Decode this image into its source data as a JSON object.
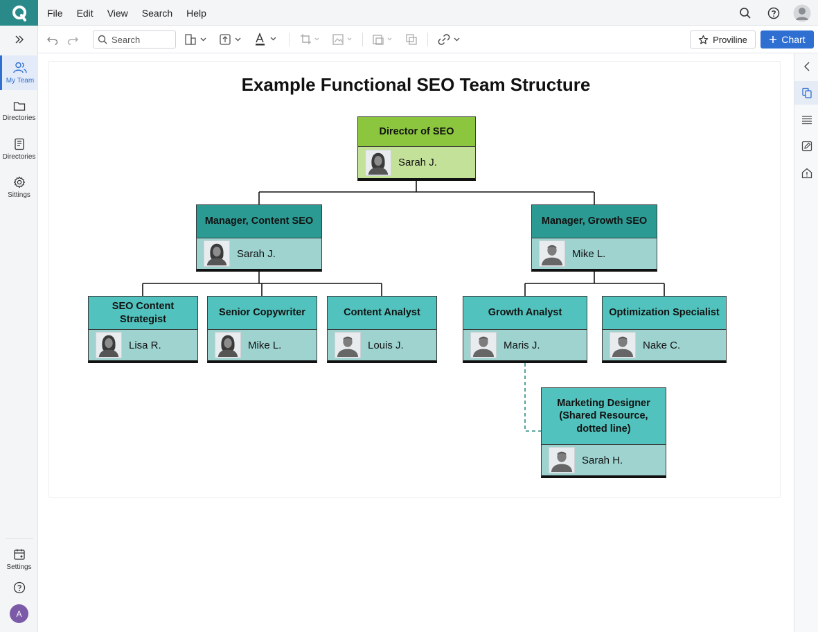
{
  "menu": {
    "items": [
      "File",
      "Edit",
      "View",
      "Search",
      "Help"
    ]
  },
  "toolbar": {
    "search_placeholder": "Search",
    "proviline_label": "Proviline",
    "chart_label": "Chart"
  },
  "sidebar": {
    "items": [
      {
        "label": "My Team",
        "icon": "people-icon",
        "active": true
      },
      {
        "label": "Directories",
        "icon": "folder-icon"
      },
      {
        "label": "Directories",
        "icon": "document-icon"
      },
      {
        "label": "Sittings",
        "icon": "gear-icon"
      }
    ],
    "bottom": {
      "settings_label": "Settings",
      "avatar_initial": "A"
    }
  },
  "colors": {
    "accent": "#2f6fd1",
    "brand": "#2a8a8a",
    "director_header": "#8cc63f",
    "manager_header": "#2b9a93",
    "staff_header": "#51c2bd",
    "person_bg": "#9ed3d0"
  },
  "org_chart": {
    "title": "Example Functional SEO Team Structure",
    "director": {
      "role": "Director of SEO",
      "name": "Sarah J.",
      "avatar": "female"
    },
    "managers": [
      {
        "role": "Manager, Content SEO",
        "name": "Sarah J.",
        "avatar": "female"
      },
      {
        "role": "Manager, Growth SEO",
        "name": "Mike L.",
        "avatar": "male"
      }
    ],
    "staff": [
      {
        "role": "SEO Content Strategist",
        "name": "Lisa R.",
        "avatar": "female",
        "reports_to": "Manager, Content SEO"
      },
      {
        "role": "Senior Copywriter",
        "name": "Mike L.",
        "avatar": "female",
        "reports_to": "Manager, Content SEO"
      },
      {
        "role": "Content Analyst",
        "name": "Louis J.",
        "avatar": "male",
        "reports_to": "Manager, Content SEO"
      },
      {
        "role": "Growth Analyst",
        "name": "Maris J.",
        "avatar": "male",
        "reports_to": "Manager, Growth SEO"
      },
      {
        "role": "Optimization Specialist",
        "name": "Nake C.",
        "avatar": "male",
        "reports_to": "Manager, Growth SEO"
      }
    ],
    "shared": {
      "role": "Marketing Designer (Shared Resource, dotted line)",
      "name": "Sarah H.",
      "avatar": "male",
      "dotted_to": "Growth Analyst"
    }
  }
}
